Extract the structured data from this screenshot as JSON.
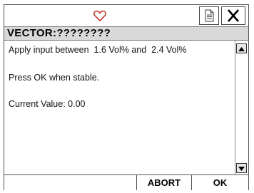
{
  "header": {
    "title": "VECTOR:????????"
  },
  "toolbar": {
    "heart_icon": "heart-icon",
    "document_icon": "document-icon",
    "close_icon": "close-icon",
    "accent_color": "#c0392b"
  },
  "content": {
    "instruction": "Apply input between  1.6 Vol% and  2.4 Vol%",
    "prompt": "Press OK when stable.",
    "current_value": "Current Value: 0.00"
  },
  "footer": {
    "abort_label": "ABORT",
    "ok_label": "OK"
  }
}
